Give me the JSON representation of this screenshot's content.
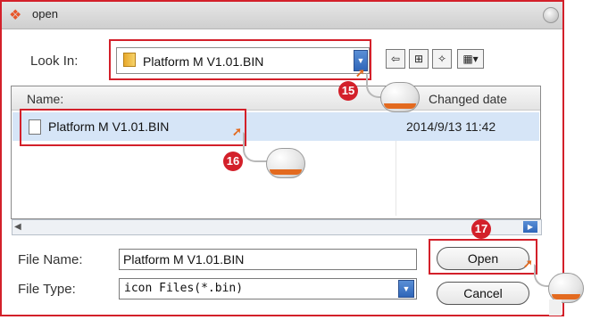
{
  "window": {
    "title": "open"
  },
  "look_in": {
    "label": "Look In:",
    "value": "Platform M V1.01.BIN"
  },
  "toolbar": {
    "icons": [
      "up-folder-icon",
      "parent-folder-icon",
      "new-folder-icon",
      "view-menu-icon"
    ]
  },
  "file_list": {
    "columns": [
      "Name:",
      "Changed date"
    ],
    "rows": [
      {
        "name": "Platform M V1.01.BIN",
        "date": "2014/9/13 11:42",
        "selected": true
      }
    ]
  },
  "file_name": {
    "label": "File Name:",
    "value": "Platform M V1.01.BIN"
  },
  "file_type": {
    "label": "File Type:",
    "value": "icon Files(*.bin)"
  },
  "buttons": {
    "open": "Open",
    "cancel": "Cancel"
  },
  "steps": [
    "15",
    "16",
    "17"
  ],
  "colors": {
    "highlight_border": "#d3202a",
    "selection": "#d6e5f7",
    "accent_blue": "#2f66b9",
    "mouse_orange": "#e36a1f"
  }
}
